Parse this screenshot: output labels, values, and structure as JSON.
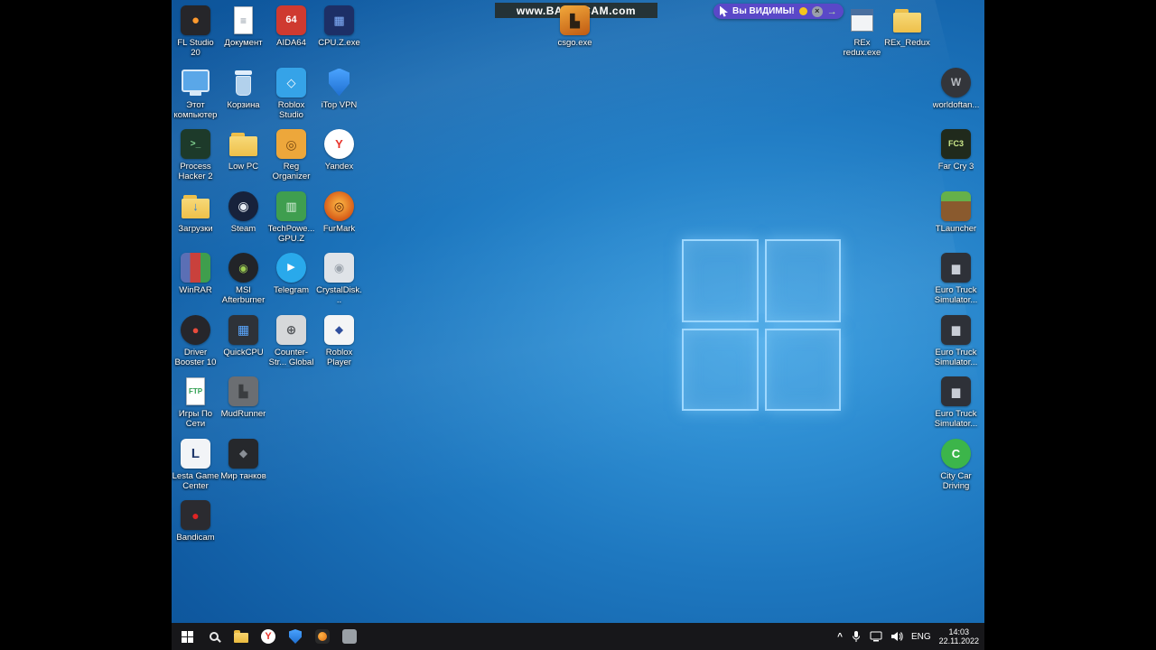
{
  "watermark": {
    "text": "www.BANDICAM.com"
  },
  "status_overlay": {
    "text": "Вы ВИДИМЫ!",
    "close_glyph": "×",
    "arrow_glyph": "→"
  },
  "colors": {
    "desktop_blue": "#1e78c0",
    "taskbar_bg": "#17171a",
    "overlay_purple": "#5a48c8",
    "indicator_yellow": "#f5c51e",
    "folder_yellow": "#eec04a",
    "logo_glow": "#9fd8ff"
  },
  "desktop": {
    "left_icons": [
      {
        "id": "fl-studio-20",
        "label": "FL Studio 20",
        "col": 1,
        "row": 1,
        "shape": "square",
        "bg": "#26262a",
        "fg": "#ff9a2e",
        "glyph": "●",
        "gsize": 15
      },
      {
        "id": "this-pc",
        "label": "Этот компьютер",
        "col": 1,
        "row": 2,
        "shape": "monitor",
        "bg": "#5aa7e8"
      },
      {
        "id": "process-hacker-2",
        "label": "Process Hacker 2",
        "col": 1,
        "row": 3,
        "shape": "square",
        "bg": "#1d3a2a",
        "fg": "#86d996",
        "glyph": ">_",
        "gsize": 10
      },
      {
        "id": "downloads",
        "label": "Загрузки",
        "col": 1,
        "row": 4,
        "shape": "folder",
        "fg": "#2f7fd6",
        "glyph": "↓",
        "gsize": 13
      },
      {
        "id": "winrar",
        "label": "WinRAR",
        "col": 1,
        "row": 5,
        "shape": "square",
        "bg": "linear-gradient(90deg,#5b6fb5 0 32%,#c9413c 32% 66%,#3f9e4d 66% 100%)",
        "fg": "#ffffff"
      },
      {
        "id": "driver-booster-10",
        "label": "Driver Booster 10",
        "col": 1,
        "row": 6,
        "shape": "circle",
        "bg": "#26262b",
        "fg": "#e84b3c",
        "glyph": "●",
        "gsize": 13
      },
      {
        "id": "ftp-games",
        "label": "Игры По Сети",
        "col": 1,
        "row": 7,
        "shape": "page",
        "fg": "#2e9e4f",
        "glyph": "FTP",
        "gsize": 8
      },
      {
        "id": "lesta-game-center",
        "label": "Lesta Game Center",
        "col": 1,
        "row": 8,
        "shape": "square",
        "bg": "#f2f4f7",
        "fg": "#20386b",
        "glyph": "L",
        "gsize": 15
      },
      {
        "id": "bandicam",
        "label": "Bandicam",
        "col": 1,
        "row": 9,
        "shape": "square",
        "bg": "#2b2b30",
        "fg": "#e02424",
        "glyph": "●",
        "gsize": 14
      },
      {
        "id": "document",
        "label": "Документ",
        "col": 2,
        "row": 1,
        "shape": "page",
        "fg": "#8a94a0",
        "glyph": "≡",
        "gsize": 12
      },
      {
        "id": "recycle-bin",
        "label": "Корзина",
        "col": 2,
        "row": 2,
        "shape": "bin",
        "bg": "rgba(205,228,248,0.85)",
        "fg": "rgba(236,246,255,0.95)"
      },
      {
        "id": "low-pc",
        "label": "Low PC",
        "col": 2,
        "row": 3,
        "shape": "folder"
      },
      {
        "id": "steam",
        "label": "Steam",
        "col": 2,
        "row": 4,
        "shape": "circle",
        "bg": "#17223b",
        "fg": "#e8eef5",
        "glyph": "◉",
        "gsize": 14
      },
      {
        "id": "msi-afterburner",
        "label": "MSI Afterburner",
        "col": 2,
        "row": 5,
        "shape": "circle",
        "bg": "#222428",
        "fg": "#9ccd52",
        "glyph": "◉",
        "gsize": 12
      },
      {
        "id": "quickcpu",
        "label": "QuickCPU",
        "col": 2,
        "row": 6,
        "shape": "square",
        "bg": "#2e3238",
        "fg": "#5aa7ff",
        "glyph": "▦",
        "gsize": 14
      },
      {
        "id": "mudrunner",
        "label": "MudRunner",
        "col": 2,
        "row": 7,
        "shape": "square",
        "bg": "#6b6e72",
        "fg": "#3a3d40",
        "glyph": "▙",
        "gsize": 13
      },
      {
        "id": "mir-tankov",
        "label": "Мир танков",
        "col": 2,
        "row": 8,
        "shape": "square",
        "bg": "#26282c",
        "fg": "#8a8f96",
        "glyph": "◆",
        "gsize": 12
      },
      {
        "id": "aida64",
        "label": "AIDA64",
        "col": 3,
        "row": 1,
        "shape": "square",
        "bg": "#cf3a30",
        "fg": "#ffffff",
        "glyph": "64",
        "gsize": 11
      },
      {
        "id": "roblox-studio",
        "label": "Roblox Studio",
        "col": 3,
        "row": 2,
        "shape": "square",
        "bg": "#35a3e8",
        "fg": "#ffffff",
        "glyph": "◇",
        "gsize": 13
      },
      {
        "id": "reg-organizer",
        "label": "Reg Organizer",
        "col": 3,
        "row": 3,
        "shape": "square",
        "bg": "#eda73b",
        "fg": "#7a4b12",
        "glyph": "◎",
        "gsize": 14
      },
      {
        "id": "gpu-z",
        "label": "TechPowe... GPU.Z",
        "col": 3,
        "row": 4,
        "shape": "square",
        "bg": "#3f9e4f",
        "fg": "#d8f0dc",
        "glyph": "▥",
        "gsize": 13
      },
      {
        "id": "telegram",
        "label": "Telegram",
        "col": 3,
        "row": 5,
        "shape": "circle",
        "bg": "#29a9eb",
        "fg": "#ffffff",
        "glyph": "▶",
        "gsize": 11
      },
      {
        "id": "counter-strike",
        "label": "Counter-Str... Global Offe...",
        "col": 3,
        "row": 6,
        "shape": "square",
        "bg": "#d6d8da",
        "fg": "#55585c",
        "glyph": "⊕",
        "gsize": 14
      },
      {
        "id": "cpu-z",
        "label": "CPU.Z.exe",
        "col": 4,
        "row": 1,
        "shape": "square",
        "bg": "#1d2f66",
        "fg": "#86b4ff",
        "glyph": "▦",
        "gsize": 13
      },
      {
        "id": "itop-vpn",
        "label": "iTop VPN",
        "col": 4,
        "row": 2,
        "shape": "shield",
        "bg": "linear-gradient(#4aa3ff,#1f6fd0)"
      },
      {
        "id": "yandex",
        "label": "Yandex",
        "col": 4,
        "row": 3,
        "shape": "circle",
        "bg": "#ffffff",
        "fg": "#e8332a",
        "glyph": "Y",
        "gsize": 13
      },
      {
        "id": "furmark",
        "label": "FurMark",
        "col": 4,
        "row": 4,
        "shape": "circle",
        "bg": "radial-gradient(circle at 50% 45%,#f6a73c 15%,#d35414 75%)",
        "fg": "#5a2208",
        "glyph": "◎",
        "gsize": 13
      },
      {
        "id": "crystaldiskinfo",
        "label": "CrystalDisk...",
        "col": 4,
        "row": 5,
        "shape": "square",
        "bg": "#dfe3e8",
        "fg": "#9aa2ab",
        "glyph": "◉",
        "gsize": 13
      },
      {
        "id": "roblox-player",
        "label": "Roblox Player",
        "col": 4,
        "row": 6,
        "shape": "square",
        "bg": "#f4f5f6",
        "fg": "#2f4f9e",
        "glyph": "◆",
        "gsize": 12
      }
    ],
    "top_icon": {
      "id": "csgo-exe",
      "label": "csgo.exe",
      "shape": "square",
      "bg": "linear-gradient(160deg,#f2a93b,#c05a12)",
      "fg": "#2b2014",
      "glyph": "▙",
      "gsize": 14
    },
    "rex_exe_icon": {
      "id": "rex-redux-exe",
      "label": "REx redux.exe",
      "shape": "window"
    },
    "rex_folder_icon": {
      "id": "rex-redux-folder",
      "label": "REx_Redux",
      "shape": "folder"
    },
    "right_icons": [
      {
        "id": "world-of-tanks",
        "label": "worldoftan...",
        "row": 2,
        "shape": "circle",
        "bg": "#33353a",
        "fg": "#b6bac0",
        "glyph": "W",
        "gsize": 12
      },
      {
        "id": "far-cry-3",
        "label": "Far Cry 3",
        "row": 3,
        "shape": "square",
        "bg": "#202a1c",
        "fg": "#cde98a",
        "glyph": "FC3",
        "gsize": 9
      },
      {
        "id": "tlauncher",
        "label": "TLauncher",
        "row": 4,
        "shape": "square",
        "bg": "linear-gradient(#65b04a 0 34%,#8a5a2e 34% 100%)"
      },
      {
        "id": "euro-truck-1",
        "label": "Euro Truck Simulator...",
        "row": 5,
        "shape": "square",
        "bg": "#2e3138",
        "fg": "#c8cdd6",
        "glyph": "▆",
        "gsize": 12
      },
      {
        "id": "euro-truck-2",
        "label": "Euro Truck Simulator...",
        "row": 6,
        "shape": "square",
        "bg": "#2e3138",
        "fg": "#c8cdd6",
        "glyph": "▆",
        "gsize": 12
      },
      {
        "id": "euro-truck-3",
        "label": "Euro Truck Simulator...",
        "row": 7,
        "shape": "square",
        "bg": "#2e3138",
        "fg": "#c8cdd6",
        "glyph": "▆",
        "gsize": 12
      },
      {
        "id": "city-car-driving",
        "label": "City Car Driving",
        "row": 8,
        "shape": "circle",
        "bg": "#3cb54a",
        "fg": "#ffffff",
        "glyph": "C",
        "gsize": 13
      }
    ]
  },
  "taskbar": {
    "buttons": [
      "start",
      "search",
      "file-explorer",
      "yandex-browser",
      "security-shield",
      "fl-studio",
      "app"
    ],
    "yandex_glyph": "Y",
    "tray": {
      "hidden_icons_glyph": "^",
      "icons": [
        "microphone",
        "network",
        "volume"
      ],
      "lang": "ENG",
      "time": "14:03",
      "date": "22.11.2022"
    }
  }
}
